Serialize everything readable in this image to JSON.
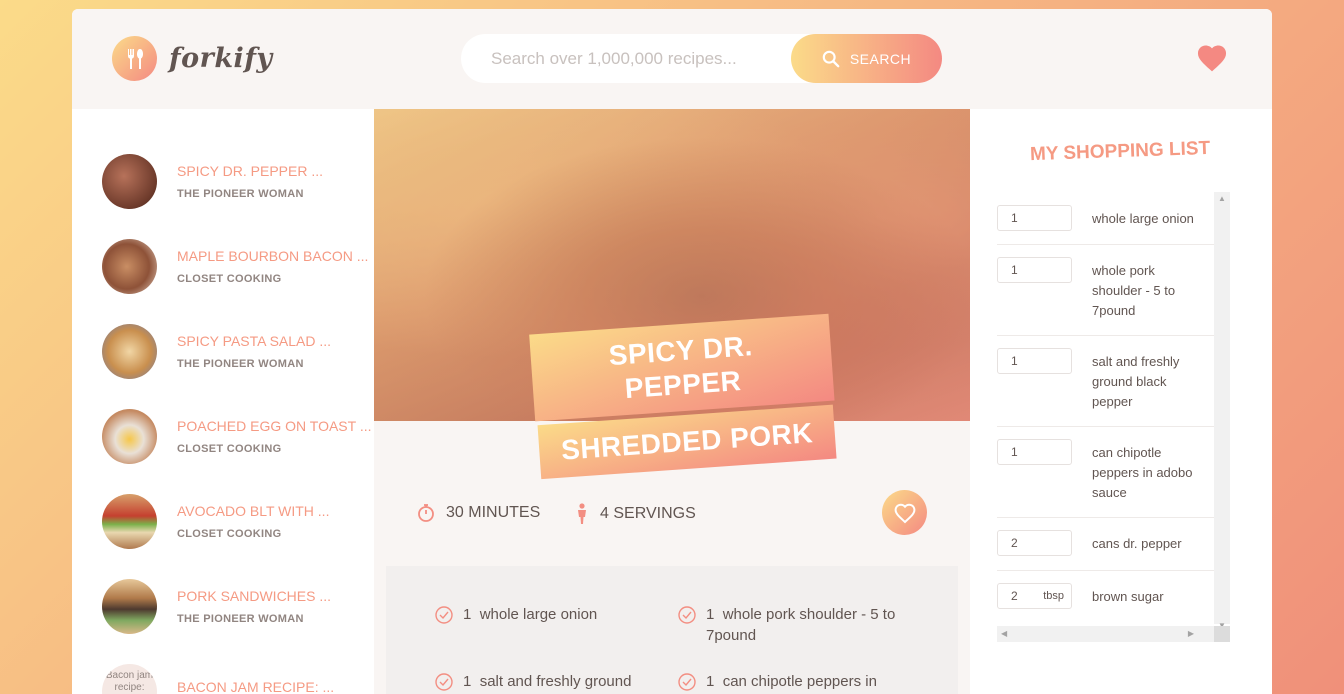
{
  "header": {
    "logo_text": "forkify",
    "search_placeholder": "Search over 1,000,000 recipes...",
    "search_button_label": "SEARCH"
  },
  "colors": {
    "accent_start": "#fbdb89",
    "accent_end": "#f48982",
    "text": "#615551"
  },
  "results": [
    {
      "title": "SPICY DR. PEPPER ...",
      "author": "THE PIONEER WOMAN",
      "thumb": "#8a4f39"
    },
    {
      "title": "MAPLE BOURBON BACON ...",
      "author": "CLOSET COOKING",
      "thumb": "#b8866a"
    },
    {
      "title": "SPICY PASTA SALAD ...",
      "author": "THE PIONEER WOMAN",
      "thumb": "#c9a07a"
    },
    {
      "title": "POACHED EGG ON TOAST ...",
      "author": "CLOSET COOKING",
      "thumb": "#d8a889"
    },
    {
      "title": "AVOCADO BLT WITH ...",
      "author": "CLOSET COOKING",
      "thumb": "#a36d4a"
    },
    {
      "title": "PORK SANDWICHES ...",
      "author": "THE PIONEER WOMAN",
      "thumb": "#6e4a36"
    },
    {
      "title": "BACON JAM RECIPE: ...",
      "author": "",
      "thumb_alt": "Bacon jam recipe:"
    }
  ],
  "recipe": {
    "title_line1": "SPICY DR. PEPPER",
    "title_line2": "SHREDDED PORK",
    "time": "30",
    "time_unit": "MINUTES",
    "servings": "4",
    "servings_unit": "SERVINGS",
    "ingredients": [
      {
        "count": "1",
        "text": "whole large onion"
      },
      {
        "count": "1",
        "text": "whole pork shoulder - 5 to 7pound"
      },
      {
        "count": "1",
        "text": "salt and freshly ground"
      },
      {
        "count": "1",
        "text": "can chipotle peppers in"
      }
    ]
  },
  "shopping": {
    "heading": "MY SHOPPING LIST",
    "items": [
      {
        "count": "1",
        "unit": "",
        "desc": "whole large onion"
      },
      {
        "count": "1",
        "unit": "",
        "desc": "whole pork shoulder - 5 to 7pound"
      },
      {
        "count": "1",
        "unit": "",
        "desc": "salt and freshly ground black pepper"
      },
      {
        "count": "1",
        "unit": "",
        "desc": "can chipotle peppers in adobo sauce"
      },
      {
        "count": "2",
        "unit": "",
        "desc": "cans dr. pepper"
      },
      {
        "count": "2",
        "unit": "tbsp",
        "desc": "brown sugar"
      }
    ]
  }
}
